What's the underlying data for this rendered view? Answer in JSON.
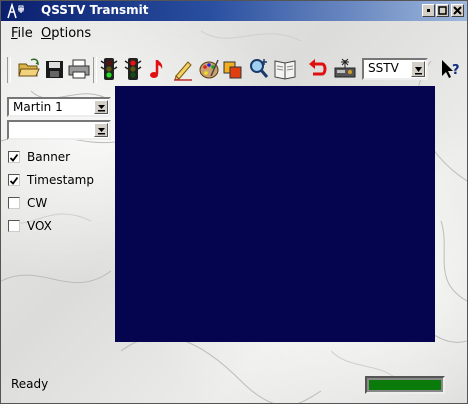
{
  "window": {
    "title": "QSSTV Transmit"
  },
  "menubar": {
    "file": "File",
    "options": "Options"
  },
  "toolbar": {
    "tools": [
      "open-folder-icon",
      "save-disk-icon",
      "print-icon",
      "traffic-light-green-icon",
      "traffic-light-red-icon",
      "music-note-icon",
      "pencil-edit-icon",
      "paint-palette-icon",
      "overlay-squares-icon",
      "zoom-in-icon",
      "book-icon",
      "undo-arrow-icon",
      "transmit-device-icon"
    ],
    "mode_select": "SSTV",
    "help_icon": "whats-this-help-icon"
  },
  "sidebar": {
    "mode_combo": "Martin 1",
    "second_combo": "",
    "options": [
      {
        "label": "Banner",
        "checked": true
      },
      {
        "label": "Timestamp",
        "checked": true
      },
      {
        "label": "CW",
        "checked": false
      },
      {
        "label": "VOX",
        "checked": false
      }
    ]
  },
  "image": {
    "color": "#05054f"
  },
  "statusbar": {
    "text": "Ready",
    "progress": 1.0,
    "progress_color": "#0a7a0a"
  },
  "colors": {
    "titlebar_left": "#0a1f6e",
    "titlebar_right": "#9fb8dc"
  }
}
